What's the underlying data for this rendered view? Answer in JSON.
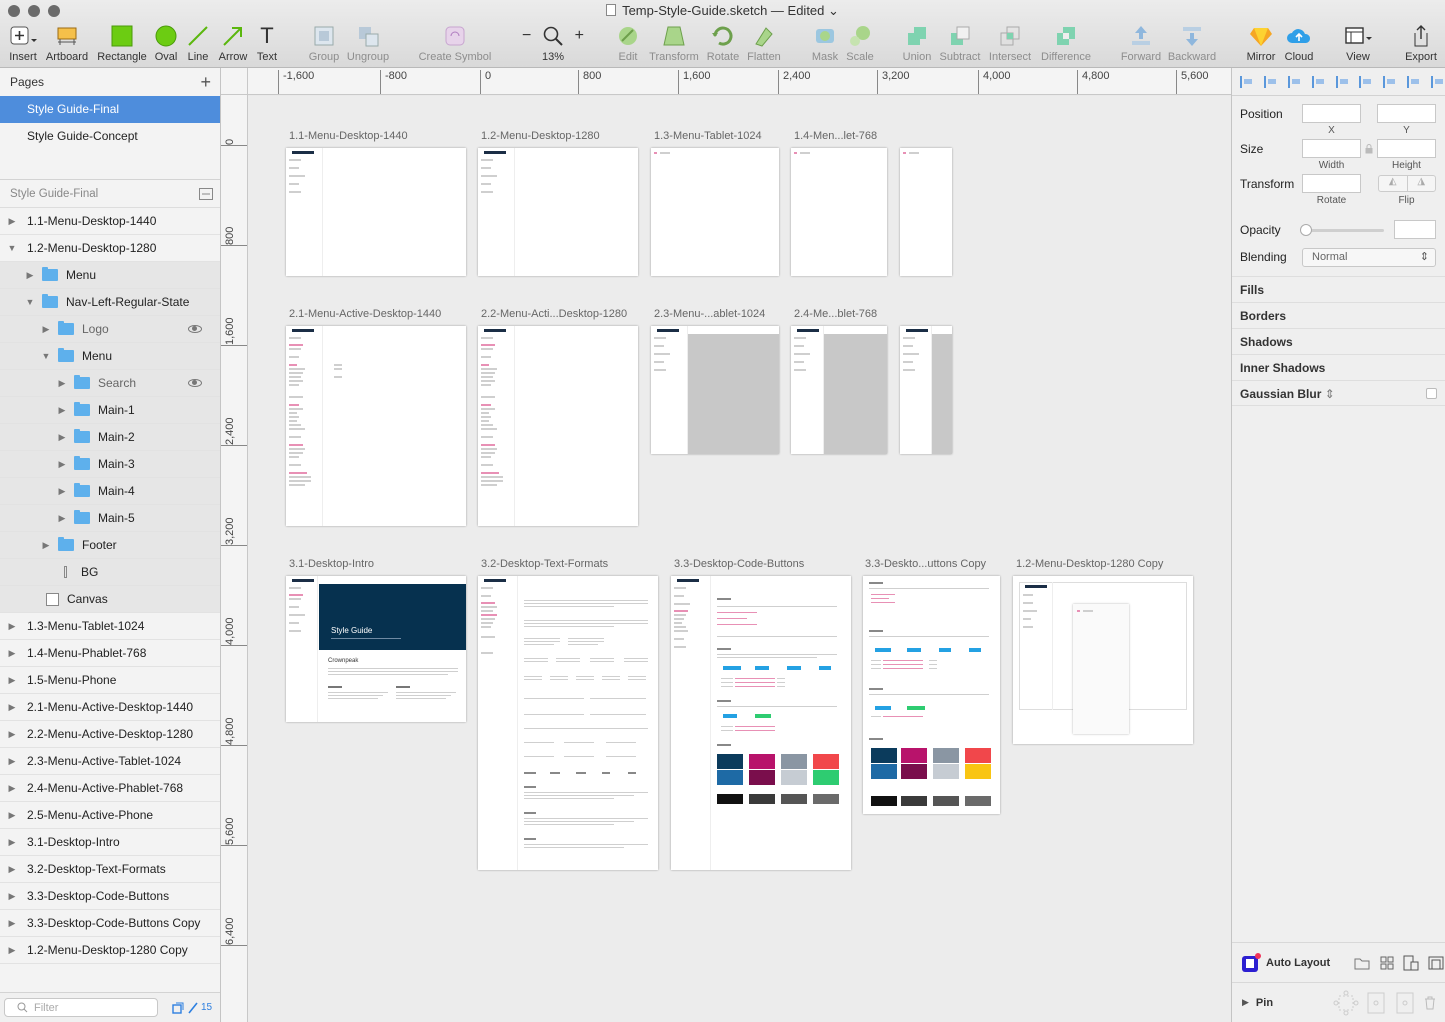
{
  "window": {
    "title": "Temp-Style-Guide.sketch — Edited",
    "traffic_colors": [
      "#6b6b6b",
      "#6b6b6b",
      "#6b6b6b"
    ]
  },
  "toolbar": {
    "insert": "Insert",
    "artboard": "Artboard",
    "rectangle": "Rectangle",
    "oval": "Oval",
    "line": "Line",
    "arrow": "Arrow",
    "text": "Text",
    "group": "Group",
    "ungroup": "Ungroup",
    "create_symbol": "Create Symbol",
    "zoom_minus": "−",
    "zoom_plus": "+",
    "zoom_value": "13%",
    "edit": "Edit",
    "transform": "Transform",
    "rotate": "Rotate",
    "flatten": "Flatten",
    "mask": "Mask",
    "scale": "Scale",
    "union": "Union",
    "subtract": "Subtract",
    "intersect": "Intersect",
    "difference": "Difference",
    "forward": "Forward",
    "backward": "Backward",
    "mirror": "Mirror",
    "cloud": "Cloud",
    "view": "View",
    "export": "Export"
  },
  "pages": {
    "header": "Pages",
    "add": "+",
    "items": [
      "Style Guide-Final",
      "Style Guide-Concept"
    ],
    "active_color": "#4e8ddc"
  },
  "layers": {
    "header": "Style Guide-Final",
    "items": [
      "1.1-Menu-Desktop-1440",
      "1.2-Menu-Desktop-1280",
      "Menu",
      "Nav-Left-Regular-State",
      "Logo",
      "Menu",
      "Search",
      "Main-1",
      "Main-2",
      "Main-3",
      "Main-4",
      "Main-5",
      "Footer",
      "BG",
      "Canvas",
      "1.3-Menu-Tablet-1024",
      "1.4-Menu-Phablet-768",
      "1.5-Menu-Phone",
      "2.1-Menu-Active-Desktop-1440",
      "2.2-Menu-Active-Desktop-1280",
      "2.3-Menu-Active-Tablet-1024",
      "2.4-Menu-Active-Phablet-768",
      "2.5-Menu-Active-Phone",
      "3.1-Desktop-Intro",
      "3.2-Desktop-Text-Formats",
      "3.3-Desktop-Code-Buttons",
      "3.3-Desktop-Code-Buttons Copy",
      "1.2-Menu-Desktop-1280 Copy"
    ],
    "filter_placeholder": "Filter",
    "count": "15"
  },
  "rulers": {
    "h": [
      "-1,600",
      "-800",
      "0",
      "800",
      "1,600",
      "2,400",
      "3,200",
      "4,000",
      "4,800",
      "5,600"
    ],
    "v": [
      "0",
      "800",
      "1,600",
      "2,400",
      "3,200",
      "4,000",
      "4,800",
      "5,600",
      "6,400"
    ]
  },
  "artboards": {
    "row1": [
      "1.1-Menu-Desktop-1440",
      "1.2-Menu-Desktop-1280",
      "1.3-Menu-Tablet-1024",
      "1.4-Men...let-768"
    ],
    "row2": [
      "2.1-Menu-Active-Desktop-1440",
      "2.2-Menu-Acti...Desktop-1280",
      "2.3-Menu-...ablet-1024",
      "2.4-Me...blet-768"
    ],
    "row3": [
      "3.1-Desktop-Intro",
      "3.2-Desktop-Text-Formats",
      "3.3-Desktop-Code-Buttons",
      "3.3-Deskto...uttons Copy",
      "1.2-Menu-Desktop-1280 Copy"
    ],
    "hero_title": "Style Guide",
    "hero_brand": "Crownpeak",
    "hero_color": "#06314f",
    "swatch_colors": [
      "#0b3b5c",
      "#1e6aa5",
      "#b8136b",
      "#7a0e4c",
      "#8a96a3",
      "#c6ccd3",
      "#f1474b",
      "#f9c513",
      "#2ecc71",
      "#111111",
      "#3a3a3a",
      "#555555",
      "#6a6a6a"
    ]
  },
  "inspector": {
    "position": "Position",
    "x": "X",
    "y": "Y",
    "size": "Size",
    "width": "Width",
    "height": "Height",
    "transform": "Transform",
    "rotate": "Rotate",
    "flip": "Flip",
    "opacity": "Opacity",
    "blending": "Blending",
    "blending_value": "Normal",
    "fills": "Fills",
    "borders": "Borders",
    "shadows": "Shadows",
    "inner_shadows": "Inner Shadows",
    "gaussian_blur": "Gaussian Blur",
    "auto_layout": "Auto Layout",
    "pin": "Pin"
  }
}
